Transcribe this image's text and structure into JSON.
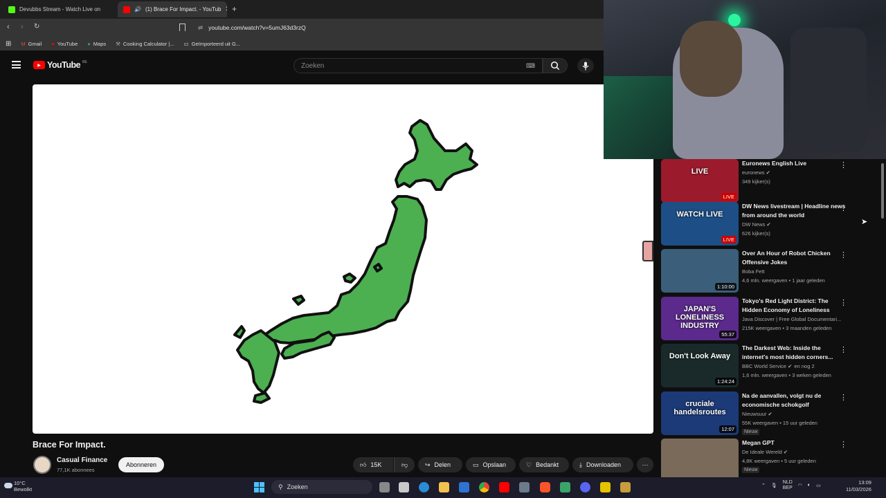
{
  "browser": {
    "tabs": [
      {
        "title": "Devubbs Stream - Watch Live on",
        "favicon_color": "#53fc18"
      },
      {
        "title": "(1) Brace For Impact. - YouTub",
        "favicon_color": "#ff0000"
      }
    ],
    "new_tab": "+",
    "url": "youtube.com/watch?v=5umJ63d3rzQ",
    "bookmarks": [
      {
        "label": "Gmail",
        "icon": "gmail-icon"
      },
      {
        "label": "YouTube",
        "icon": "youtube-icon"
      },
      {
        "label": "Maps",
        "icon": "maps-icon"
      },
      {
        "label": "Cooking Calculator |...",
        "icon": "calculator-icon"
      },
      {
        "label": "Geïmporteerd uit G...",
        "icon": "folder-icon"
      }
    ]
  },
  "youtube": {
    "logo": "YouTube",
    "country": "BE",
    "search_placeholder": "Zoeken"
  },
  "video": {
    "title": "Brace For Impact.",
    "channel": "Casual Finance",
    "subscribers": "77,1K abonnees",
    "subscribe_label": "Abonneren",
    "likes": "15K",
    "share": "Delen",
    "save": "Opslaan",
    "thanks": "Bedankt",
    "download": "Downloaden",
    "map_fill": "#4caf50"
  },
  "sidebar": {
    "items": [
      {
        "title": "Euronews English Live",
        "channel": "euronews",
        "verified": true,
        "meta": "349 kijker(s)",
        "badge": "LIVE",
        "live": true,
        "thumb_text": "LIVE",
        "thumb_color": "#9b1b2c"
      },
      {
        "title": "DW News livestream | Headline news from around the world",
        "channel": "DW News",
        "verified": true,
        "meta": "626 kijker(s)",
        "badge": "LIVE",
        "live": true,
        "thumb_text": "WATCH LIVE",
        "thumb_color": "#1d4f86"
      },
      {
        "title": "Over An Hour of Robot Chicken Offensive Jokes",
        "channel": "Boba Fett",
        "verified": false,
        "meta": "4,6 mln. weergaven • 1 jaar geleden",
        "badge": "1:10:00",
        "live": false,
        "thumb_text": "",
        "thumb_color": "#3b5f7a"
      },
      {
        "title": "Tokyo's Red Light District: The Hidden Economy of Loneliness",
        "channel": "Java Discover | Free Global Documentari...",
        "verified": false,
        "meta": "215K weergaven • 3 maanden geleden",
        "badge": "55:37",
        "live": false,
        "thumb_text": "JAPAN'S LONELINESS INDUSTRY",
        "thumb_color": "#5b2a8c"
      },
      {
        "title": "The Darkest Web: Inside the internet's most hidden corners...",
        "channel": "BBC World Service",
        "verified": true,
        "channel_extra": "en nog 2",
        "meta": "1,6 mln. weergaven • 3 weken geleden",
        "badge": "1:24:24",
        "live": false,
        "thumb_text": "Don't Look Away",
        "thumb_color": "#1a2a2a"
      },
      {
        "title": "Na de aanvallen, volgt nu de economische schokgolf",
        "channel": "Nieuwsuur",
        "verified": true,
        "meta": "55K weergaven • 15 uur geleden",
        "new": "Nieuw",
        "badge": "12:07",
        "live": false,
        "thumb_text": "cruciale handelsroutes",
        "thumb_color": "#1c3a78"
      },
      {
        "title": "Megan GPT",
        "channel": "De Ideale Wereld",
        "verified": true,
        "meta": "4,8K weergaven • 5 uur geleden",
        "new": "Nieuw",
        "badge": "",
        "live": false,
        "thumb_text": "",
        "thumb_color": "#7a6a5a"
      }
    ]
  },
  "taskbar": {
    "temperature": "10°C",
    "weather": "Bewolkt",
    "search": "Zoeken",
    "lang": "NLD",
    "lang2": "BEP",
    "time": "13:09",
    "date": "11/03/2026"
  }
}
